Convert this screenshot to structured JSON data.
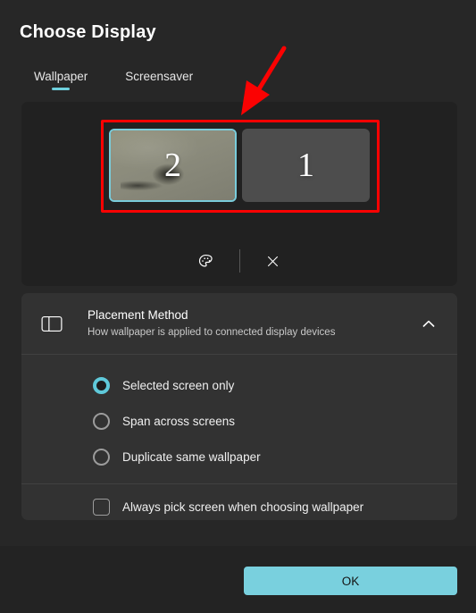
{
  "dialog": {
    "title": "Choose Display"
  },
  "tabs": [
    {
      "label": "Wallpaper",
      "active": true
    },
    {
      "label": "Screensaver",
      "active": false
    }
  ],
  "preview": {
    "monitors": [
      {
        "number": "2",
        "selected": true,
        "has_wallpaper": true
      },
      {
        "number": "1",
        "selected": false,
        "has_wallpaper": false
      }
    ],
    "actions": [
      {
        "icon": "palette-icon",
        "name": "choose-color-button"
      },
      {
        "icon": "close-icon",
        "name": "remove-wallpaper-button"
      }
    ]
  },
  "placement_section": {
    "icon": "panel-layout-icon",
    "title": "Placement Method",
    "subtitle": "How wallpaper is applied to connected display devices",
    "expanded": true,
    "chevron": "chevron-up-icon",
    "options": [
      {
        "label": "Selected screen only",
        "checked": true
      },
      {
        "label": "Span across screens",
        "checked": false
      },
      {
        "label": "Duplicate same wallpaper",
        "checked": false
      }
    ],
    "checkbox": {
      "label": "Always pick screen when choosing wallpaper",
      "checked": false
    }
  },
  "footer": {
    "ok_label": "OK"
  },
  "colors": {
    "accent": "#79d0de",
    "accent_radio": "#5fc9da",
    "tab_underline": "#6ed0dd",
    "window_bg": "#272727",
    "preview_bg": "#212121",
    "card_bg": "#323232",
    "footer_bg": "#232323",
    "annotation_red": "#fb0202",
    "monitor_inactive": "#4d4d4d",
    "wallpaper_tone": "#8b8b7c"
  }
}
